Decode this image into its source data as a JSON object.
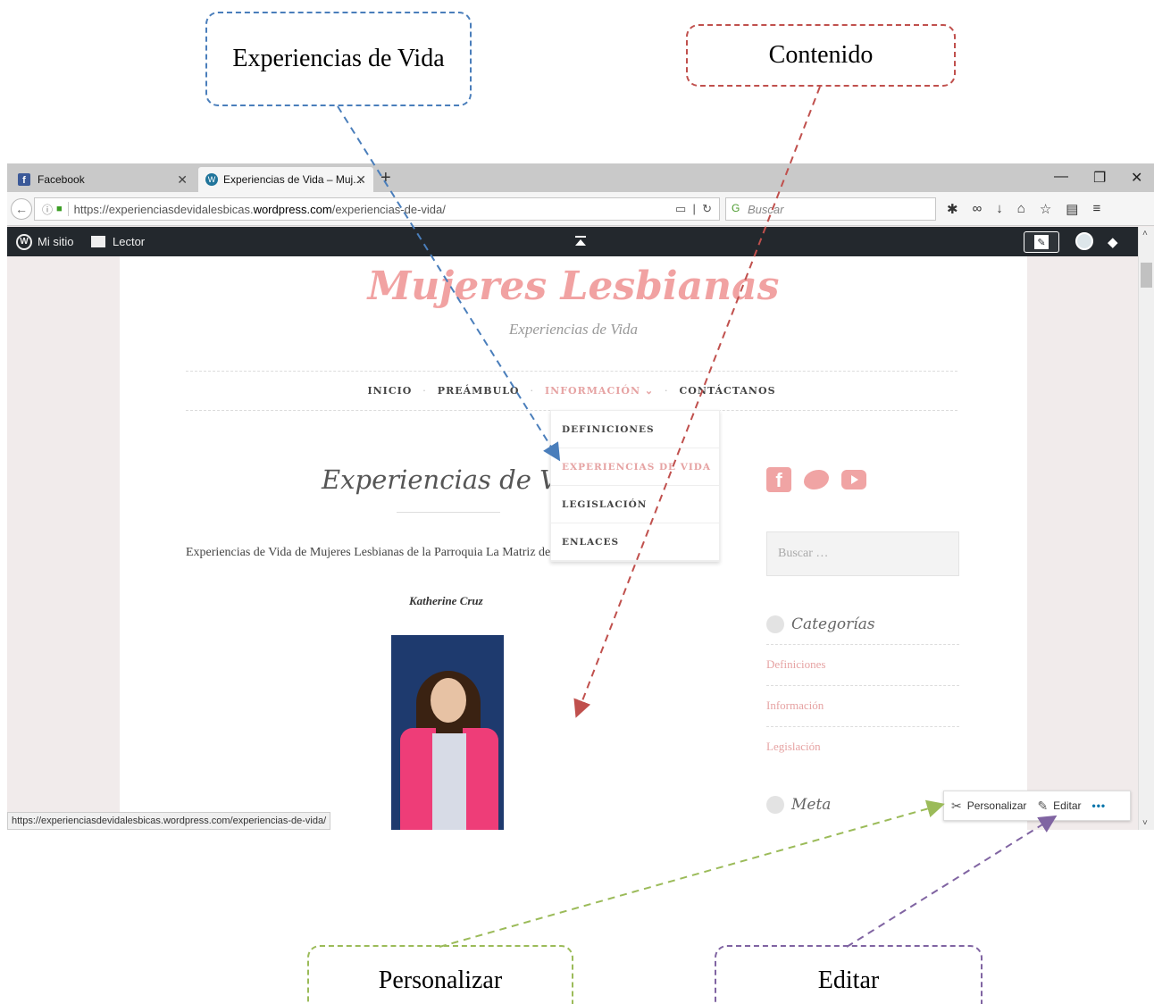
{
  "annotations": {
    "experiencias": "Experiencias de Vida",
    "contenido": "Contenido",
    "personalizar": "Personalizar",
    "editar": "Editar"
  },
  "browser": {
    "tabs": [
      {
        "label": "Facebook",
        "favicon": "facebook-icon",
        "active": false
      },
      {
        "label": "Experiencias de Vida – Muj...",
        "favicon": "wordpress-icon",
        "active": true
      }
    ],
    "url_prefix": "https://experienciasdevidalesbicas.",
    "url_domain": "wordpress.com",
    "url_suffix": "/experiencias-de-vida/",
    "search_placeholder": "Buscar",
    "status_url": "https://experienciasdevidalesbicas.wordpress.com/experiencias-de-vida/"
  },
  "wpbar": {
    "my_site": "Mi sitio",
    "reader": "Lector"
  },
  "site": {
    "title": "Mujeres Lesbianas",
    "tagline": "Experiencias de Vida",
    "menu": [
      {
        "label": "INICIO"
      },
      {
        "label": "PREÁMBULO"
      },
      {
        "label": "INFORMACIÓN ⌄",
        "active": true
      },
      {
        "label": "CONTÁCTANOS"
      }
    ],
    "dropdown": [
      {
        "label": "DEFINICIONES"
      },
      {
        "label": "EXPERIENCIAS DE VIDA",
        "selected": true
      },
      {
        "label": "LEGISLACIÓN"
      },
      {
        "label": "ENLACES"
      }
    ]
  },
  "content": {
    "page_title": "Experiencias de Vida",
    "intro": "Experiencias de Vida de Mujeres Lesbianas de la Parroquia La Matriz de Ambato.",
    "author": "Katherine Cruz"
  },
  "sidebar": {
    "search_placeholder": "Buscar …",
    "categories_title": "Categorías",
    "categories": [
      "Definiciones",
      "Información",
      "Legislación"
    ],
    "meta_title": "Meta"
  },
  "floatbar": {
    "customize": "Personalizar",
    "edit": "Editar",
    "more": "•••"
  },
  "colors": {
    "accent_pink": "#f1a2a2",
    "wp_admin_bar": "#23282d"
  }
}
